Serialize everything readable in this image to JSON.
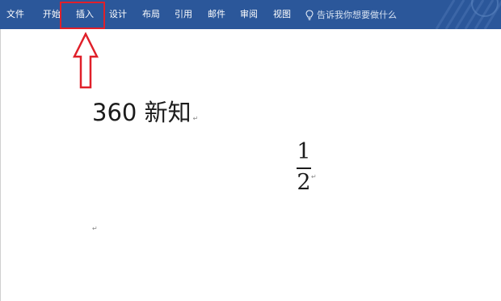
{
  "ribbon": {
    "tabs": [
      {
        "id": "file",
        "label": "文件"
      },
      {
        "id": "home",
        "label": "开始"
      },
      {
        "id": "insert",
        "label": "插入"
      },
      {
        "id": "design",
        "label": "设计"
      },
      {
        "id": "layout",
        "label": "布局"
      },
      {
        "id": "references",
        "label": "引用"
      },
      {
        "id": "mailings",
        "label": "邮件"
      },
      {
        "id": "review",
        "label": "审阅"
      },
      {
        "id": "view",
        "label": "视图"
      }
    ],
    "tell_me": "告诉我你想要做什么",
    "tell_me_icon": "lightbulb-icon",
    "highlighted_tab": "insert"
  },
  "annotation": {
    "color": "#e0202a",
    "icon": "up-arrow-icon"
  },
  "document": {
    "line1": "360 新知",
    "paragraph_mark": "↵",
    "fraction": {
      "numerator": "1",
      "denominator": "2"
    }
  },
  "colors": {
    "ribbon": "#2b579a",
    "text": "#1c1c1c"
  }
}
